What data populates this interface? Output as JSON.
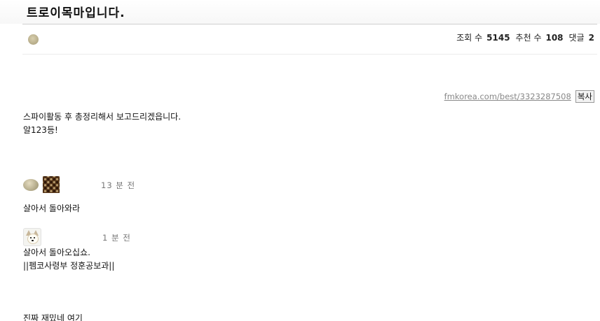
{
  "post": {
    "title": "트로이목마입니다.",
    "stats": {
      "views_label": "조회 수",
      "views": "5145",
      "recommend_label": "추천 수",
      "recommend": "108",
      "comments_label": "댓글",
      "comments": "2"
    },
    "link": {
      "url_text": "fmkorea.com/best/3323287508",
      "copy_label": "복사"
    },
    "body_lines": [
      "스파이활동 후 총정리해서 보고드리겠읍니다.",
      "알123등!"
    ]
  },
  "comments": [
    {
      "time": "13 분 전",
      "lines": [
        "살아서 돌아와라"
      ]
    },
    {
      "time": "1 분 전",
      "lines": [
        "살아서 돌아오십쇼.",
        "||펨코사령부 정훈공보과||"
      ]
    },
    {
      "time": "",
      "lines": [
        "진짜 재밌네 여기"
      ]
    }
  ]
}
